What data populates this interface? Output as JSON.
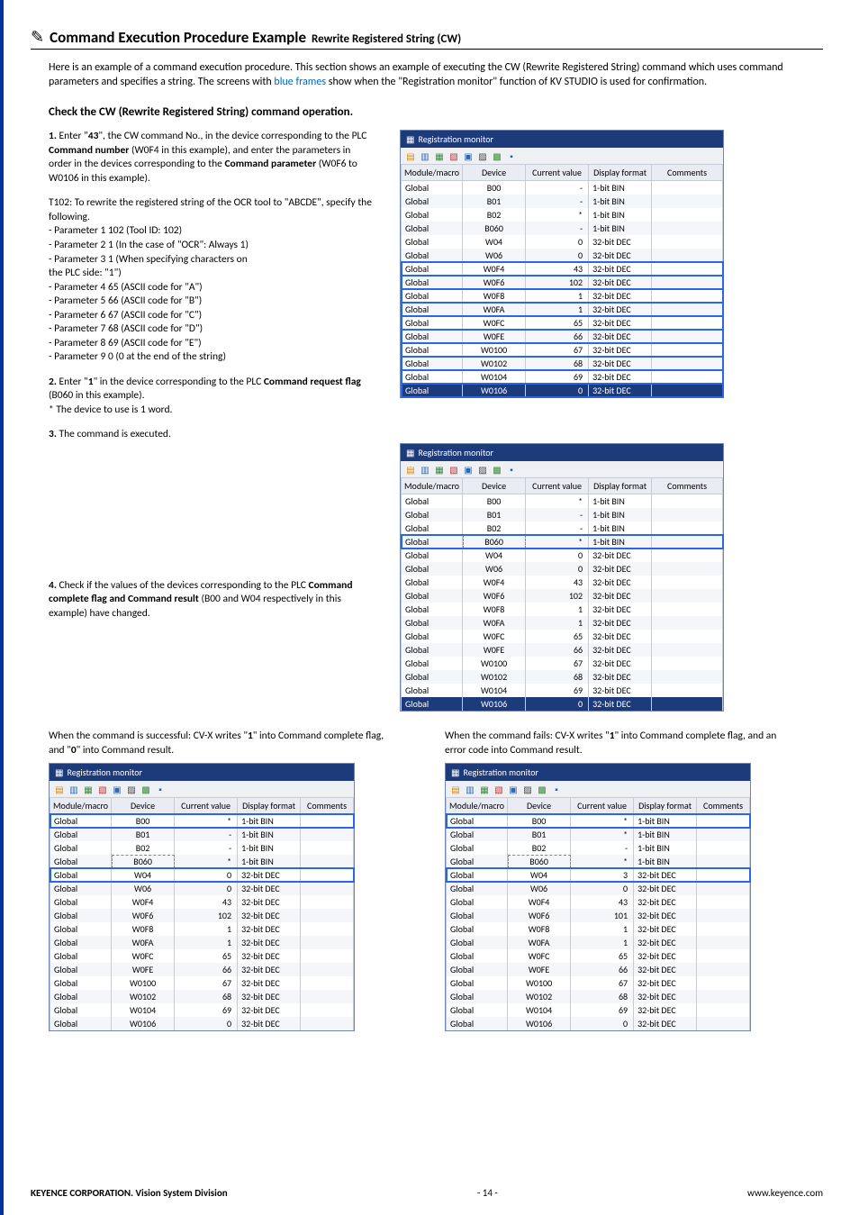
{
  "heading": {
    "icon": "✎",
    "main": "Command Execution Procedure Example",
    "sub": "Rewrite Registered String (CW)"
  },
  "intro_prefix": "Here is an example of a command execution procedure. This section shows an example of executing the CW (Rewrite Registered String) command which uses command parameters and specifies a string. The screens with ",
  "intro_blue": "blue frames",
  "intro_suffix": " show when the \"Registration monitor\" function of KV STUDIO is used for confirmation.",
  "subheading": "Check the CW (Rewrite Registered String) command operation.",
  "step1": {
    "label": "1.",
    "t1a": " Enter \"",
    "cmdno": "43",
    "t1b": "\", the CW command No., in the device corresponding to the PLC ",
    "bold1": "Command number",
    "t1c": " (W0F4 in this example), and enter the parameters in order in the devices corresponding to the ",
    "bold2": "Command parameter",
    "t1d": " (W0F6 to W0106 in this example)."
  },
  "t102_head": "T102: To rewrite the registered string of the OCR tool to \"ABCDE\", specify the following.",
  "t102_lines": [
    "- Parameter 1  102  (Tool ID: 102)",
    "- Parameter 2  1  (In the case of \"OCR\": Always 1)",
    "- Parameter 3  1  (When specifying characters on",
    "  the PLC side: \"1\")",
    "- Parameter 4  65  (ASCII code for \"A\")",
    "- Parameter 5  66  (ASCII code for \"B\")",
    "- Parameter 6  67  (ASCII code for \"C\")",
    "- Parameter 7  68  (ASCII code for \"D\")",
    "- Parameter 8  69  (ASCII code for \"E\")",
    "- Parameter 9  0  (0 at the end of the string)"
  ],
  "step2": {
    "label": "2.",
    "t1": " Enter \"",
    "one": "1",
    "t2": "\" in the device corresponding to the PLC ",
    "bold": "Command request flag",
    "t3": " (B060 in this example).",
    "note": "* The device to use is 1 word."
  },
  "step3": {
    "label": "3.",
    "text": " The command is executed."
  },
  "step4": {
    "label": "4.",
    "t1": " Check if the values of the devices corresponding to the PLC ",
    "bold": "Command complete flag and Command result",
    "t2": " (B00 and W04 respectively in this example) have changed."
  },
  "success_caption_a": "When the command is successful: CV-X writes \"",
  "success_caption_b": "\" into Command complete flag, and \"",
  "success_caption_c": "\" into Command result.",
  "success_one": "1",
  "success_zero": "0",
  "fail_caption_a": "When the command fails: CV-X writes \"",
  "fail_caption_b": "\" into Command complete flag, and an error code into Command result.",
  "fail_one": "1",
  "monitor_title": "Registration monitor",
  "headers": {
    "mod": "Module/macro",
    "dev": "Device",
    "val": "Current value",
    "fmt": "Display format",
    "cmt": "Comments"
  },
  "panel1_rows": [
    {
      "m": "Global",
      "d": "B00",
      "v": "-",
      "f": "1-bit BIN"
    },
    {
      "m": "Global",
      "d": "B01",
      "v": "-",
      "f": "1-bit BIN"
    },
    {
      "m": "Global",
      "d": "B02",
      "v": "*",
      "f": "1-bit BIN"
    },
    {
      "m": "Global",
      "d": "B060",
      "v": "-",
      "f": "1-bit BIN"
    },
    {
      "m": "Global",
      "d": "W04",
      "v": "0",
      "f": "32-bit DEC"
    },
    {
      "m": "Global",
      "d": "W06",
      "v": "0",
      "f": "32-bit DEC"
    },
    {
      "m": "Global",
      "d": "W0F4",
      "v": "43",
      "f": "32-bit DEC",
      "bf": true
    },
    {
      "m": "Global",
      "d": "W0F6",
      "v": "102",
      "f": "32-bit DEC",
      "bf": true
    },
    {
      "m": "Global",
      "d": "W0F8",
      "v": "1",
      "f": "32-bit DEC",
      "bf": true
    },
    {
      "m": "Global",
      "d": "W0FA",
      "v": "1",
      "f": "32-bit DEC",
      "bf": true
    },
    {
      "m": "Global",
      "d": "W0FC",
      "v": "65",
      "f": "32-bit DEC",
      "bf": true
    },
    {
      "m": "Global",
      "d": "W0FE",
      "v": "66",
      "f": "32-bit DEC",
      "bf": true
    },
    {
      "m": "Global",
      "d": "W0100",
      "v": "67",
      "f": "32-bit DEC",
      "bf": true
    },
    {
      "m": "Global",
      "d": "W0102",
      "v": "68",
      "f": "32-bit DEC",
      "bf": true
    },
    {
      "m": "Global",
      "d": "W0104",
      "v": "69",
      "f": "32-bit DEC",
      "bf": true
    },
    {
      "m": "Global",
      "d": "W0106",
      "v": "0",
      "f": "32-bit DEC",
      "bf": true,
      "sel": true
    }
  ],
  "panel2_rows": [
    {
      "m": "Global",
      "d": "B00",
      "v": "*",
      "f": "1-bit BIN"
    },
    {
      "m": "Global",
      "d": "B01",
      "v": "-",
      "f": "1-bit BIN"
    },
    {
      "m": "Global",
      "d": "B02",
      "v": "-",
      "f": "1-bit BIN"
    },
    {
      "m": "Global",
      "d": "B060",
      "v": "*",
      "f": "1-bit BIN",
      "bf": true,
      "dash": true
    },
    {
      "m": "Global",
      "d": "W04",
      "v": "0",
      "f": "32-bit DEC"
    },
    {
      "m": "Global",
      "d": "W06",
      "v": "0",
      "f": "32-bit DEC"
    },
    {
      "m": "Global",
      "d": "W0F4",
      "v": "43",
      "f": "32-bit DEC"
    },
    {
      "m": "Global",
      "d": "W0F6",
      "v": "102",
      "f": "32-bit DEC"
    },
    {
      "m": "Global",
      "d": "W0F8",
      "v": "1",
      "f": "32-bit DEC"
    },
    {
      "m": "Global",
      "d": "W0FA",
      "v": "1",
      "f": "32-bit DEC"
    },
    {
      "m": "Global",
      "d": "W0FC",
      "v": "65",
      "f": "32-bit DEC"
    },
    {
      "m": "Global",
      "d": "W0FE",
      "v": "66",
      "f": "32-bit DEC"
    },
    {
      "m": "Global",
      "d": "W0100",
      "v": "67",
      "f": "32-bit DEC"
    },
    {
      "m": "Global",
      "d": "W0102",
      "v": "68",
      "f": "32-bit DEC"
    },
    {
      "m": "Global",
      "d": "W0104",
      "v": "69",
      "f": "32-bit DEC"
    },
    {
      "m": "Global",
      "d": "W0106",
      "v": "0",
      "f": "32-bit DEC",
      "sel": true
    }
  ],
  "panel3_rows": [
    {
      "m": "Global",
      "d": "B00",
      "v": "*",
      "f": "1-bit BIN",
      "bf": true
    },
    {
      "m": "Global",
      "d": "B01",
      "v": "-",
      "f": "1-bit BIN"
    },
    {
      "m": "Global",
      "d": "B02",
      "v": "-",
      "f": "1-bit BIN"
    },
    {
      "m": "Global",
      "d": "B060",
      "v": "*",
      "f": "1-bit BIN",
      "dash": true
    },
    {
      "m": "Global",
      "d": "W04",
      "v": "0",
      "f": "32-bit DEC",
      "bf": true
    },
    {
      "m": "Global",
      "d": "W06",
      "v": "0",
      "f": "32-bit DEC"
    },
    {
      "m": "Global",
      "d": "W0F4",
      "v": "43",
      "f": "32-bit DEC"
    },
    {
      "m": "Global",
      "d": "W0F6",
      "v": "102",
      "f": "32-bit DEC"
    },
    {
      "m": "Global",
      "d": "W0F8",
      "v": "1",
      "f": "32-bit DEC"
    },
    {
      "m": "Global",
      "d": "W0FA",
      "v": "1",
      "f": "32-bit DEC"
    },
    {
      "m": "Global",
      "d": "W0FC",
      "v": "65",
      "f": "32-bit DEC"
    },
    {
      "m": "Global",
      "d": "W0FE",
      "v": "66",
      "f": "32-bit DEC"
    },
    {
      "m": "Global",
      "d": "W0100",
      "v": "67",
      "f": "32-bit DEC"
    },
    {
      "m": "Global",
      "d": "W0102",
      "v": "68",
      "f": "32-bit DEC"
    },
    {
      "m": "Global",
      "d": "W0104",
      "v": "69",
      "f": "32-bit DEC"
    },
    {
      "m": "Global",
      "d": "W0106",
      "v": "0",
      "f": "32-bit DEC"
    }
  ],
  "panel4_rows": [
    {
      "m": "Global",
      "d": "B00",
      "v": "*",
      "f": "1-bit BIN",
      "bf": true
    },
    {
      "m": "Global",
      "d": "B01",
      "v": "*",
      "f": "1-bit BIN"
    },
    {
      "m": "Global",
      "d": "B02",
      "v": "-",
      "f": "1-bit BIN"
    },
    {
      "m": "Global",
      "d": "B060",
      "v": "*",
      "f": "1-bit BIN",
      "dash": true
    },
    {
      "m": "Global",
      "d": "W04",
      "v": "3",
      "f": "32-bit DEC",
      "bf": true
    },
    {
      "m": "Global",
      "d": "W06",
      "v": "0",
      "f": "32-bit DEC"
    },
    {
      "m": "Global",
      "d": "W0F4",
      "v": "43",
      "f": "32-bit DEC"
    },
    {
      "m": "Global",
      "d": "W0F6",
      "v": "101",
      "f": "32-bit DEC"
    },
    {
      "m": "Global",
      "d": "W0F8",
      "v": "1",
      "f": "32-bit DEC"
    },
    {
      "m": "Global",
      "d": "W0FA",
      "v": "1",
      "f": "32-bit DEC"
    },
    {
      "m": "Global",
      "d": "W0FC",
      "v": "65",
      "f": "32-bit DEC"
    },
    {
      "m": "Global",
      "d": "W0FE",
      "v": "66",
      "f": "32-bit DEC"
    },
    {
      "m": "Global",
      "d": "W0100",
      "v": "67",
      "f": "32-bit DEC"
    },
    {
      "m": "Global",
      "d": "W0102",
      "v": "68",
      "f": "32-bit DEC"
    },
    {
      "m": "Global",
      "d": "W0104",
      "v": "69",
      "f": "32-bit DEC"
    },
    {
      "m": "Global",
      "d": "W0106",
      "v": "0",
      "f": "32-bit DEC"
    }
  ],
  "footer": {
    "left": "KEYENCE CORPORATION. Vision System Division",
    "mid": "- 14 -",
    "right": "www.keyence.com"
  }
}
